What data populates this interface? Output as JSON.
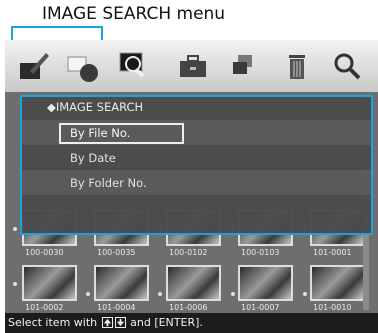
{
  "annotation": {
    "title": "IMAGE SEARCH menu",
    "accent_color": "#1aa3e0"
  },
  "toolbar": {
    "icons": [
      "pen-icon",
      "palette-icon",
      "search-image-icon",
      "toolbox-icon",
      "copy-icon",
      "trash-icon",
      "magnifier-icon"
    ]
  },
  "menu": {
    "heading": "◆IMAGE SEARCH",
    "items": [
      {
        "label": "By File No.",
        "selected": true
      },
      {
        "label": "By Date",
        "selected": false
      },
      {
        "label": "By Folder No.",
        "selected": false
      }
    ]
  },
  "thumbnails": {
    "row1": [
      "100-0030",
      "100-0035",
      "100-0102",
      "100-0103",
      "101-0001"
    ],
    "row2": [
      "101-0002",
      "101-0004",
      "101-0006",
      "101-0007",
      "101-0010"
    ]
  },
  "statusbar": {
    "prefix": "Select item with ",
    "suffix": " and [ENTER]."
  }
}
